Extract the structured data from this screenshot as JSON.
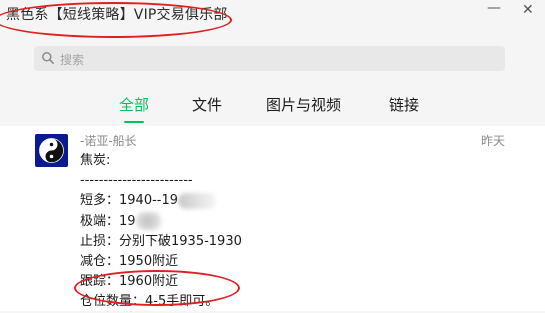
{
  "window": {
    "title": "黑色系【短线策略】VIP交易俱乐部",
    "minimize_icon": "—",
    "close_icon": "✕"
  },
  "search": {
    "placeholder": "搜索"
  },
  "tabs": [
    {
      "label": "全部",
      "active": true
    },
    {
      "label": "文件",
      "active": false
    },
    {
      "label": "图片与视频",
      "active": false
    },
    {
      "label": "链接",
      "active": false
    }
  ],
  "message": {
    "sender": "-诺亚-船长",
    "timestamp": "昨天",
    "avatar_icon": "yin-yang-icon",
    "lines": [
      "焦炭:",
      "------------------------",
      "短多：1940--19",
      "极端：19",
      "止损：分别下破1935-1930",
      "减仓：1950附近",
      "跟踪：1960附近",
      "仓位数量：4-5手即可。"
    ]
  },
  "colors": {
    "accent_green": "#07c160",
    "annotation_red": "#e02020",
    "avatar_blue": "#0b1a8f"
  }
}
